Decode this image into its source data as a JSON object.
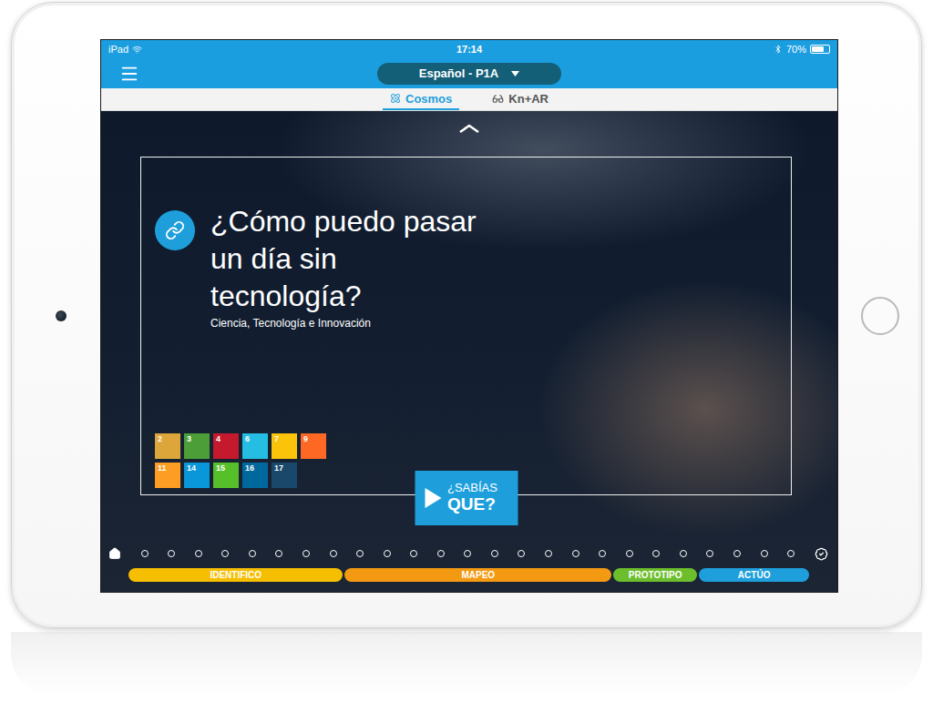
{
  "status_bar": {
    "device": "iPad",
    "time": "17:14",
    "battery": "70%",
    "battery_level": 0.7
  },
  "header": {
    "selector": "Español - P1A"
  },
  "tabs": [
    {
      "label": "Cosmos",
      "selected": true
    },
    {
      "label": "Kn+AR",
      "selected": false
    }
  ],
  "card": {
    "title": "¿Cómo puedo pasar un día sin tecnología?",
    "subtitle": "Ciencia, Tecnología e Innovación",
    "goals": [
      {
        "number": "2",
        "color": "#DDA63A"
      },
      {
        "number": "3",
        "color": "#4C9F38"
      },
      {
        "number": "4",
        "color": "#C5192D"
      },
      {
        "number": "6",
        "color": "#26BDE2"
      },
      {
        "number": "7",
        "color": "#FCC30B"
      },
      {
        "number": "9",
        "color": "#FD6925"
      },
      {
        "number": "11",
        "color": "#FD9D24"
      },
      {
        "number": "14",
        "color": "#0A97D9"
      },
      {
        "number": "15",
        "color": "#56C02B"
      },
      {
        "number": "16",
        "color": "#00689D"
      },
      {
        "number": "17",
        "color": "#19486A"
      }
    ],
    "button": {
      "line1": "¿SABÍAS",
      "line2": "QUE?"
    }
  },
  "progress": {
    "steps": [
      {
        "done": false
      },
      {
        "done": false
      },
      {
        "done": false
      },
      {
        "done": false
      },
      {
        "done": false
      },
      {
        "done": false
      },
      {
        "done": false
      },
      {
        "done": false
      },
      {
        "done": false
      },
      {
        "done": false
      },
      {
        "done": false
      },
      {
        "done": false
      },
      {
        "done": false
      },
      {
        "done": false
      },
      {
        "done": false
      },
      {
        "done": false
      },
      {
        "done": false
      },
      {
        "done": false
      },
      {
        "done": false
      },
      {
        "done": false
      },
      {
        "done": false
      },
      {
        "done": false
      },
      {
        "done": false
      },
      {
        "done": false
      },
      {
        "done": false
      }
    ]
  },
  "phases": [
    {
      "label": "IDENTIFICO",
      "color": "#F5BE00"
    },
    {
      "label": "MAPEO",
      "color": "#F39A12"
    },
    {
      "label": "PROTOTIPO",
      "color": "#6CBE2D"
    },
    {
      "label": "ACTÚO",
      "color": "#1E9FDB"
    }
  ]
}
